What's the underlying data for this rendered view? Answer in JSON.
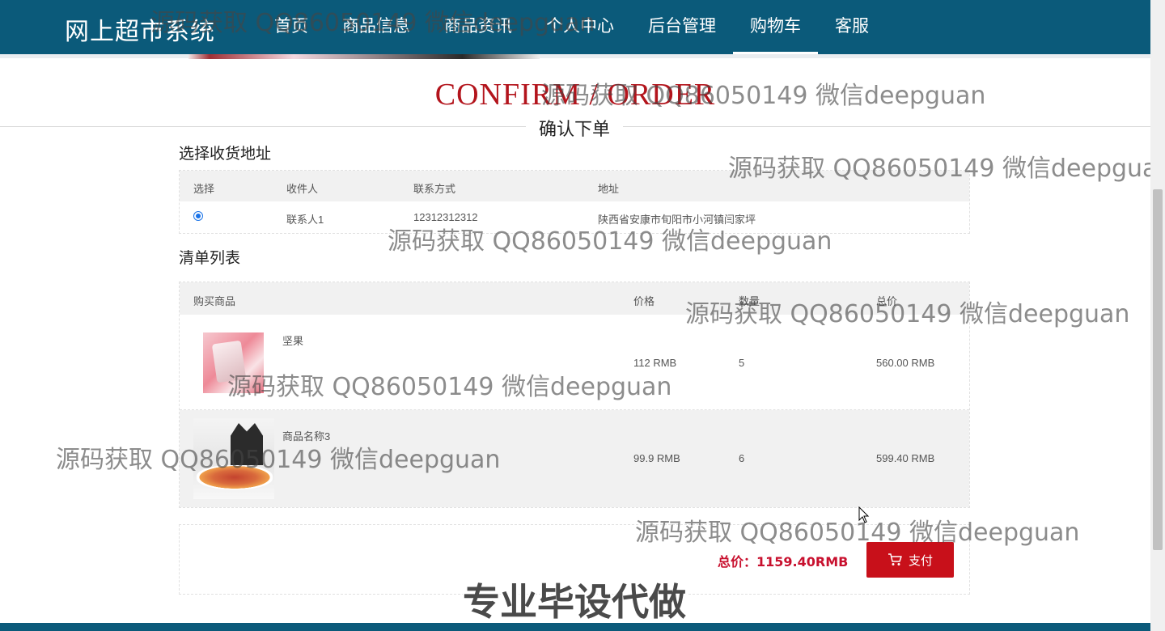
{
  "header": {
    "brand": "网上超市系统",
    "nav": [
      {
        "label": "首页",
        "active": false
      },
      {
        "label": "商品信息",
        "active": false
      },
      {
        "label": "商品资讯",
        "active": false
      },
      {
        "label": "个人中心",
        "active": false
      },
      {
        "label": "后台管理",
        "active": false
      },
      {
        "label": "购物车",
        "active": true
      },
      {
        "label": "客服",
        "active": false
      }
    ]
  },
  "page": {
    "title_en": "CONFIRM / ORDER",
    "title_cn": "确认下单"
  },
  "address": {
    "section_title": "选择收货地址",
    "columns": [
      "选择",
      "收件人",
      "联系方式",
      "地址"
    ],
    "rows": [
      {
        "selected": true,
        "name": "联系人1",
        "phone": "12312312312",
        "address": "陕西省安康市旬阳市小河镇闫家坪"
      }
    ]
  },
  "items": {
    "section_title": "清单列表",
    "columns": [
      "购买商品",
      "价格",
      "数量",
      "总价"
    ],
    "rows": [
      {
        "name": "坚果",
        "price": "112 RMB",
        "qty": "5",
        "total": "560.00 RMB"
      },
      {
        "name": "商品名称3",
        "price": "99.9 RMB",
        "qty": "6",
        "total": "599.40 RMB"
      }
    ]
  },
  "summary": {
    "total_label": "总价：1159.40RMB",
    "pay_label": "支付"
  },
  "watermarks": {
    "text": "源码获取 QQ86050149 微信deepguan",
    "banner": "专业毕设代做"
  },
  "colors": {
    "header_bg": "#0b5a7a",
    "accent_red": "#c8101a",
    "title_red": "#b3141c"
  }
}
